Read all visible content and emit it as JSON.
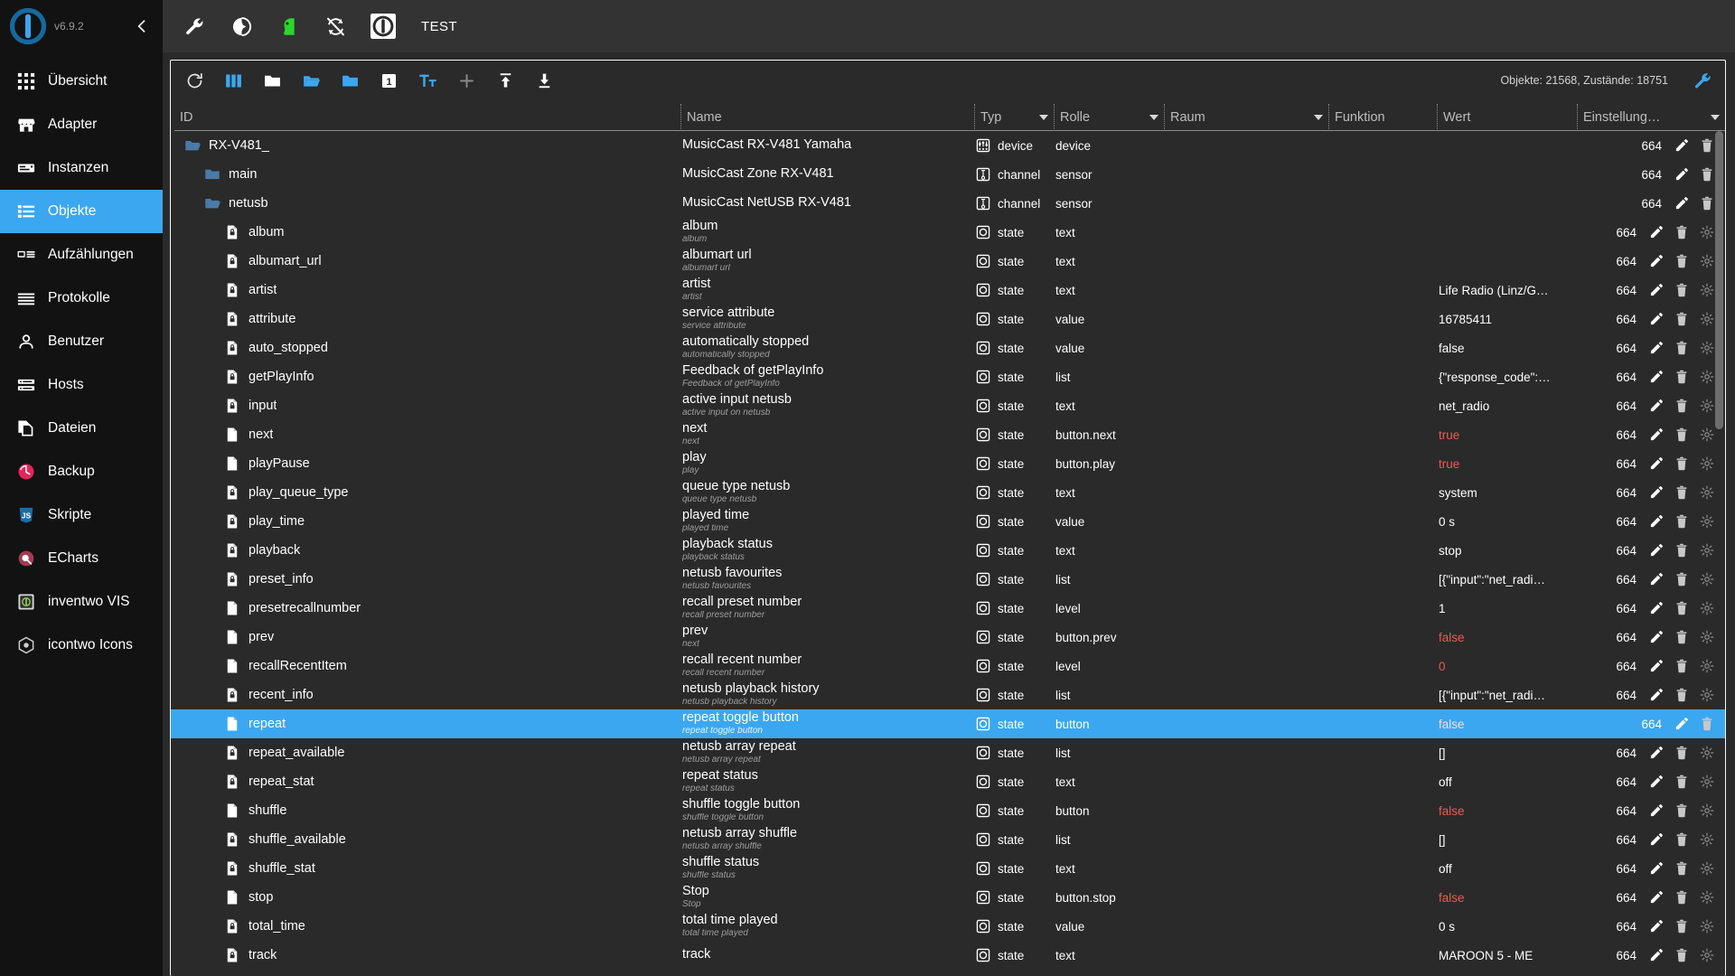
{
  "sidebar": {
    "version": "v6.9.2",
    "collapse_label": "‹",
    "items": [
      {
        "label": "Übersicht",
        "icon": "grid-icon",
        "active": false
      },
      {
        "label": "Adapter",
        "icon": "store-icon",
        "active": false
      },
      {
        "label": "Instanzen",
        "icon": "instances-icon",
        "active": false
      },
      {
        "label": "Objekte",
        "icon": "list-icon",
        "active": true
      },
      {
        "label": "Aufzählungen",
        "icon": "enum-icon",
        "active": false
      },
      {
        "label": "Protokolle",
        "icon": "log-icon",
        "active": false
      },
      {
        "label": "Benutzer",
        "icon": "user-icon",
        "active": false
      },
      {
        "label": "Hosts",
        "icon": "hosts-icon",
        "active": false
      },
      {
        "label": "Dateien",
        "icon": "files-icon",
        "active": false
      },
      {
        "label": "Backup",
        "icon": "backup-icon",
        "active": false
      },
      {
        "label": "Skripte",
        "icon": "js-icon",
        "active": false
      },
      {
        "label": "ECharts",
        "icon": "echarts-icon",
        "active": false
      },
      {
        "label": "inventwo VIS",
        "icon": "inventwo-icon",
        "active": false
      },
      {
        "label": "icontwo Icons",
        "icon": "icontwo-icon",
        "active": false
      }
    ]
  },
  "topbar": {
    "title": "TEST",
    "icons": [
      "wrench-icon",
      "contrast-icon",
      "head-green-icon",
      "no-sync-icon",
      "iobroker-logo-icon"
    ]
  },
  "table_toolbar": {
    "icons": [
      "refresh-icon",
      "columns-icon",
      "folder-closed-icon",
      "folder-open-icon",
      "folder-filled-icon",
      "expand-level-1-icon",
      "text-size-icon",
      "add-icon",
      "upload-icon",
      "download-icon"
    ],
    "expand_level": "1",
    "status": "Objekte: 21568, Zustände: 18751",
    "settings_icon": "wrench-icon"
  },
  "columns": [
    {
      "key": "id",
      "label": "ID",
      "filter": false
    },
    {
      "key": "name",
      "label": "Name",
      "filter": false
    },
    {
      "key": "typ",
      "label": "Typ",
      "filter": true
    },
    {
      "key": "rol",
      "label": "Rolle",
      "filter": true
    },
    {
      "key": "raum",
      "label": "Raum",
      "filter": true
    },
    {
      "key": "fun",
      "label": "Funktion",
      "filter": true
    },
    {
      "key": "wert",
      "label": "Wert",
      "filter": false
    },
    {
      "key": "set",
      "label": "Einstellung…",
      "filter": true
    }
  ],
  "rows": [
    {
      "id": "RX-V481_",
      "indent": 1,
      "icon": "folder-open-icon",
      "name": "MusicCast RX-V481 Yamaha",
      "sub": "",
      "typ": "device",
      "typ_icon": "device-icon",
      "rolle": "device",
      "raum": "",
      "funktion": "",
      "wert": "",
      "wert_style": "plain",
      "setting": "664",
      "actions": [
        "edit-icon",
        "delete-icon"
      ]
    },
    {
      "id": "main",
      "indent": 2,
      "icon": "folder-closed-icon",
      "name": "MusicCast Zone RX-V481",
      "sub": "",
      "typ": "channel",
      "typ_icon": "channel-icon",
      "rolle": "sensor",
      "raum": "",
      "funktion": "",
      "wert": "",
      "wert_style": "plain",
      "setting": "664",
      "actions": [
        "edit-icon",
        "delete-icon"
      ]
    },
    {
      "id": "netusb",
      "indent": 2,
      "icon": "folder-open-icon",
      "name": "MusicCast NetUSB RX-V481",
      "sub": "",
      "typ": "channel",
      "typ_icon": "channel-icon",
      "rolle": "sensor",
      "raum": "",
      "funktion": "",
      "wert": "",
      "wert_style": "plain",
      "setting": "664",
      "actions": [
        "edit-icon",
        "delete-icon"
      ]
    },
    {
      "id": "album",
      "indent": 3,
      "icon": "state-lock-icon",
      "name": "album",
      "sub": "album",
      "typ": "state",
      "typ_icon": "state-icon",
      "rolle": "text",
      "raum": "",
      "funktion": "",
      "wert": "",
      "wert_style": "plain",
      "setting": "664",
      "actions": [
        "edit-icon",
        "delete-icon",
        "gear-icon"
      ]
    },
    {
      "id": "albumart_url",
      "indent": 3,
      "icon": "state-lock-icon",
      "name": "albumart url",
      "sub": "albumart url",
      "typ": "state",
      "typ_icon": "state-icon",
      "rolle": "text",
      "raum": "",
      "funktion": "",
      "wert": "",
      "wert_style": "plain",
      "setting": "664",
      "actions": [
        "edit-icon",
        "delete-icon",
        "gear-icon"
      ]
    },
    {
      "id": "artist",
      "indent": 3,
      "icon": "state-lock-icon",
      "name": "artist",
      "sub": "artist",
      "typ": "state",
      "typ_icon": "state-icon",
      "rolle": "text",
      "raum": "",
      "funktion": "",
      "wert": "Life Radio (Linz/G…",
      "wert_style": "plain",
      "setting": "664",
      "actions": [
        "edit-icon",
        "delete-icon",
        "gear-icon"
      ]
    },
    {
      "id": "attribute",
      "indent": 3,
      "icon": "state-lock-icon",
      "name": "service attribute",
      "sub": "service attribute",
      "typ": "state",
      "typ_icon": "state-icon",
      "rolle": "value",
      "raum": "",
      "funktion": "",
      "wert": "16785411",
      "wert_style": "plain",
      "setting": "664",
      "actions": [
        "edit-icon",
        "delete-icon",
        "gear-icon"
      ]
    },
    {
      "id": "auto_stopped",
      "indent": 3,
      "icon": "state-lock-icon",
      "name": "automatically stopped",
      "sub": "automatically stopped",
      "typ": "state",
      "typ_icon": "state-icon",
      "rolle": "value",
      "raum": "",
      "funktion": "",
      "wert": "false",
      "wert_style": "plain",
      "setting": "664",
      "actions": [
        "edit-icon",
        "delete-icon",
        "gear-icon"
      ]
    },
    {
      "id": "getPlayInfo",
      "indent": 3,
      "icon": "state-lock-icon",
      "name": "Feedback of getPlayInfo",
      "sub": "Feedback of getPlayInfo",
      "typ": "state",
      "typ_icon": "state-icon",
      "rolle": "list",
      "raum": "",
      "funktion": "",
      "wert": "{\"response_code\":…",
      "wert_style": "plain",
      "setting": "664",
      "actions": [
        "edit-icon",
        "delete-icon",
        "gear-icon"
      ]
    },
    {
      "id": "input",
      "indent": 3,
      "icon": "state-lock-icon",
      "name": "active input netusb",
      "sub": "active input on netusb",
      "typ": "state",
      "typ_icon": "state-icon",
      "rolle": "text",
      "raum": "",
      "funktion": "",
      "wert": "net_radio",
      "wert_style": "plain",
      "setting": "664",
      "actions": [
        "edit-icon",
        "delete-icon",
        "gear-icon"
      ]
    },
    {
      "id": "next",
      "indent": 3,
      "icon": "state-icon-plain",
      "name": "next",
      "sub": "next",
      "typ": "state",
      "typ_icon": "state-icon",
      "rolle": "button.next",
      "raum": "",
      "funktion": "",
      "wert": "true",
      "wert_style": "bool",
      "setting": "664",
      "actions": [
        "edit-icon",
        "delete-icon",
        "gear-icon"
      ]
    },
    {
      "id": "playPause",
      "indent": 3,
      "icon": "state-icon-plain",
      "name": "play",
      "sub": "play",
      "typ": "state",
      "typ_icon": "state-icon",
      "rolle": "button.play",
      "raum": "",
      "funktion": "",
      "wert": "true",
      "wert_style": "bool",
      "setting": "664",
      "actions": [
        "edit-icon",
        "delete-icon",
        "gear-icon"
      ]
    },
    {
      "id": "play_queue_type",
      "indent": 3,
      "icon": "state-lock-icon",
      "name": "queue type netusb",
      "sub": "queue type netusb",
      "typ": "state",
      "typ_icon": "state-icon",
      "rolle": "text",
      "raum": "",
      "funktion": "",
      "wert": "system",
      "wert_style": "plain",
      "setting": "664",
      "actions": [
        "edit-icon",
        "delete-icon",
        "gear-icon"
      ]
    },
    {
      "id": "play_time",
      "indent": 3,
      "icon": "state-lock-icon",
      "name": "played time",
      "sub": "played time",
      "typ": "state",
      "typ_icon": "state-icon",
      "rolle": "value",
      "raum": "",
      "funktion": "",
      "wert": "0 s",
      "wert_style": "plain",
      "setting": "664",
      "actions": [
        "edit-icon",
        "delete-icon",
        "gear-icon"
      ]
    },
    {
      "id": "playback",
      "indent": 3,
      "icon": "state-lock-icon",
      "name": "playback status",
      "sub": "playback status",
      "typ": "state",
      "typ_icon": "state-icon",
      "rolle": "text",
      "raum": "",
      "funktion": "",
      "wert": "stop",
      "wert_style": "plain",
      "setting": "664",
      "actions": [
        "edit-icon",
        "delete-icon",
        "gear-icon"
      ]
    },
    {
      "id": "preset_info",
      "indent": 3,
      "icon": "state-lock-icon",
      "name": "netusb favourites",
      "sub": "netusb favourites",
      "typ": "state",
      "typ_icon": "state-icon",
      "rolle": "list",
      "raum": "",
      "funktion": "",
      "wert": "[{\"input\":\"net_radi…",
      "wert_style": "plain",
      "setting": "664",
      "actions": [
        "edit-icon",
        "delete-icon",
        "gear-icon"
      ]
    },
    {
      "id": "presetrecallnumber",
      "indent": 3,
      "icon": "state-icon-plain",
      "name": "recall preset number",
      "sub": "recall preset number",
      "typ": "state",
      "typ_icon": "state-icon",
      "rolle": "level",
      "raum": "",
      "funktion": "",
      "wert": "1",
      "wert_style": "plain",
      "setting": "664",
      "actions": [
        "edit-icon",
        "delete-icon",
        "gear-icon"
      ]
    },
    {
      "id": "prev",
      "indent": 3,
      "icon": "state-icon-plain",
      "name": "prev",
      "sub": "next",
      "typ": "state",
      "typ_icon": "state-icon",
      "rolle": "button.prev",
      "raum": "",
      "funktion": "",
      "wert": "false",
      "wert_style": "bool",
      "setting": "664",
      "actions": [
        "edit-icon",
        "delete-icon",
        "gear-icon"
      ]
    },
    {
      "id": "recallRecentItem",
      "indent": 3,
      "icon": "state-icon-plain",
      "name": "recall recent number",
      "sub": "recall recent number",
      "typ": "state",
      "typ_icon": "state-icon",
      "rolle": "level",
      "raum": "",
      "funktion": "",
      "wert": "0",
      "wert_style": "num-red",
      "setting": "664",
      "actions": [
        "edit-icon",
        "delete-icon",
        "gear-icon"
      ]
    },
    {
      "id": "recent_info",
      "indent": 3,
      "icon": "state-lock-icon",
      "name": "netusb playback history",
      "sub": "netusb playback history",
      "typ": "state",
      "typ_icon": "state-icon",
      "rolle": "list",
      "raum": "",
      "funktion": "",
      "wert": "[{\"input\":\"net_radi…",
      "wert_style": "plain",
      "setting": "664",
      "actions": [
        "edit-icon",
        "delete-icon",
        "gear-icon"
      ]
    },
    {
      "id": "repeat",
      "indent": 3,
      "icon": "state-icon-plain",
      "name": "repeat toggle button",
      "sub": "repeat toggle button",
      "typ": "state",
      "typ_icon": "state-icon",
      "rolle": "button",
      "raum": "",
      "funktion": "",
      "wert": "false",
      "wert_style": "bool",
      "setting": "664",
      "actions": [
        "edit-icon",
        "delete-icon"
      ],
      "selected": true
    },
    {
      "id": "repeat_available",
      "indent": 3,
      "icon": "state-lock-icon",
      "name": "netusb array repeat",
      "sub": "netusb array repeat",
      "typ": "state",
      "typ_icon": "state-icon",
      "rolle": "list",
      "raum": "",
      "funktion": "",
      "wert": "[]",
      "wert_style": "plain",
      "setting": "664",
      "actions": [
        "edit-icon",
        "delete-icon",
        "gear-icon"
      ]
    },
    {
      "id": "repeat_stat",
      "indent": 3,
      "icon": "state-lock-icon",
      "name": "repeat status",
      "sub": "repeat status",
      "typ": "state",
      "typ_icon": "state-icon",
      "rolle": "text",
      "raum": "",
      "funktion": "",
      "wert": "off",
      "wert_style": "plain",
      "setting": "664",
      "actions": [
        "edit-icon",
        "delete-icon",
        "gear-icon"
      ]
    },
    {
      "id": "shuffle",
      "indent": 3,
      "icon": "state-icon-plain",
      "name": "shuffle toggle button",
      "sub": "shuffle toggle button",
      "typ": "state",
      "typ_icon": "state-icon",
      "rolle": "button",
      "raum": "",
      "funktion": "",
      "wert": "false",
      "wert_style": "bool",
      "setting": "664",
      "actions": [
        "edit-icon",
        "delete-icon",
        "gear-icon"
      ]
    },
    {
      "id": "shuffle_available",
      "indent": 3,
      "icon": "state-lock-icon",
      "name": "netusb array shuffle",
      "sub": "netusb array shuffle",
      "typ": "state",
      "typ_icon": "state-icon",
      "rolle": "list",
      "raum": "",
      "funktion": "",
      "wert": "[]",
      "wert_style": "plain",
      "setting": "664",
      "actions": [
        "edit-icon",
        "delete-icon",
        "gear-icon"
      ]
    },
    {
      "id": "shuffle_stat",
      "indent": 3,
      "icon": "state-lock-icon",
      "name": "shuffle status",
      "sub": "shuffle status",
      "typ": "state",
      "typ_icon": "state-icon",
      "rolle": "text",
      "raum": "",
      "funktion": "",
      "wert": "off",
      "wert_style": "plain",
      "setting": "664",
      "actions": [
        "edit-icon",
        "delete-icon",
        "gear-icon"
      ]
    },
    {
      "id": "stop",
      "indent": 3,
      "icon": "state-icon-plain",
      "name": "Stop",
      "sub": "Stop",
      "typ": "state",
      "typ_icon": "state-icon",
      "rolle": "button.stop",
      "raum": "",
      "funktion": "",
      "wert": "false",
      "wert_style": "bool",
      "setting": "664",
      "actions": [
        "edit-icon",
        "delete-icon",
        "gear-icon"
      ]
    },
    {
      "id": "total_time",
      "indent": 3,
      "icon": "state-lock-icon",
      "name": "total time played",
      "sub": "total time played",
      "typ": "state",
      "typ_icon": "state-icon",
      "rolle": "value",
      "raum": "",
      "funktion": "",
      "wert": "0 s",
      "wert_style": "plain",
      "setting": "664",
      "actions": [
        "edit-icon",
        "delete-icon",
        "gear-icon"
      ]
    },
    {
      "id": "track",
      "indent": 3,
      "icon": "state-lock-icon",
      "name": "track",
      "sub": "",
      "typ": "state",
      "typ_icon": "state-icon",
      "rolle": "text",
      "raum": "",
      "funktion": "",
      "wert": "MAROON 5 - ME",
      "wert_style": "plain",
      "setting": "664",
      "actions": [
        "edit-icon",
        "delete-icon",
        "gear-icon"
      ]
    }
  ],
  "colors": {
    "accent": "#3ba7f0",
    "sidebar_bg": "#121212",
    "panel_bg": "#2a2a2a",
    "topbar_bg": "#333333",
    "bool_red": "#ef5a52",
    "folder_blue": "#4a7ba8"
  }
}
